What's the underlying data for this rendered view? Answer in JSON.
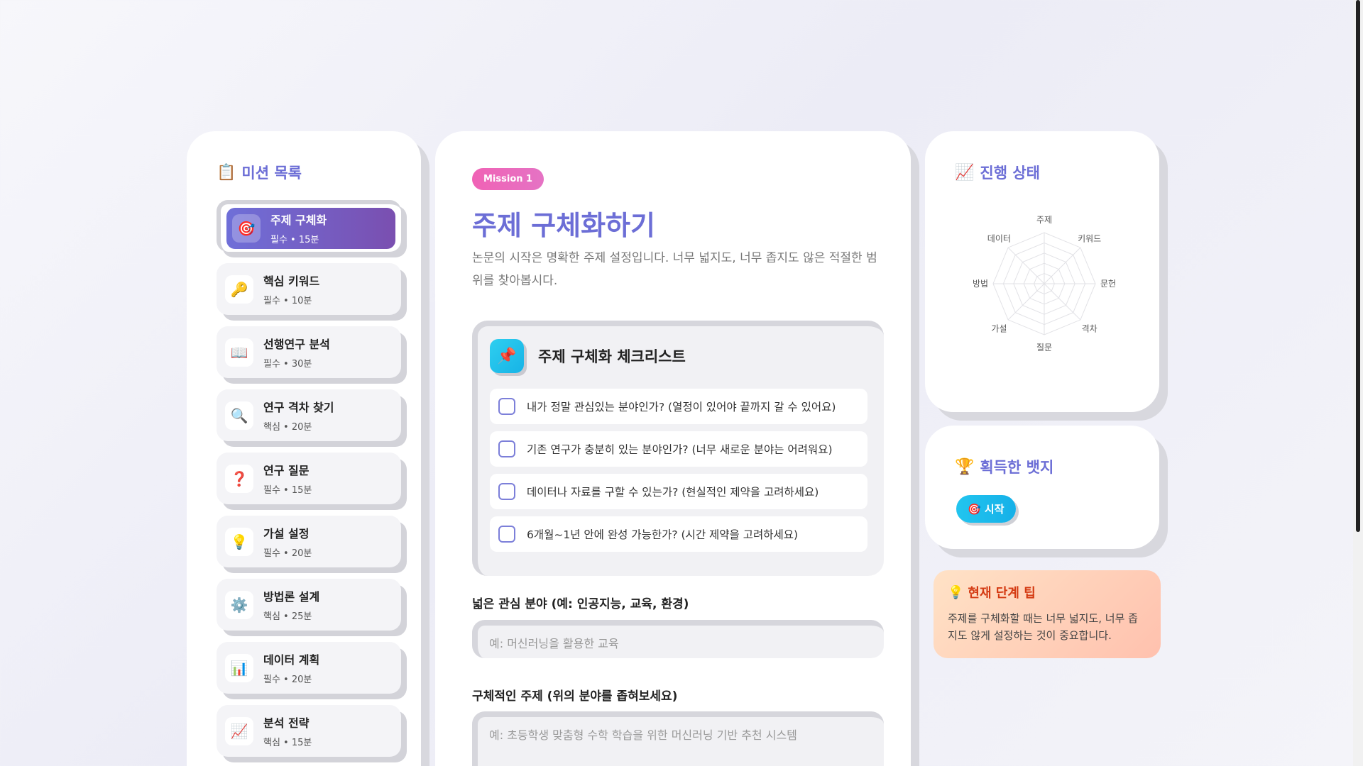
{
  "sidebar": {
    "title_emoji": "📋",
    "title": "미션 목록",
    "items": [
      {
        "icon": "🎯",
        "icon_name": "target-icon",
        "label": "주제 구체화",
        "meta": "필수 • 15분",
        "active": true
      },
      {
        "icon": "🔑",
        "icon_name": "key-icon",
        "label": "핵심 키워드",
        "meta": "필수 • 10분"
      },
      {
        "icon": "📖",
        "icon_name": "book-icon",
        "label": "선행연구 분석",
        "meta": "필수 • 30분"
      },
      {
        "icon": "🔍",
        "icon_name": "magnifier-icon",
        "label": "연구 격차 찾기",
        "meta": "핵심 • 20분"
      },
      {
        "icon": "❓",
        "icon_name": "question-icon",
        "label": "연구 질문",
        "meta": "필수 • 15분"
      },
      {
        "icon": "💡",
        "icon_name": "lightbulb-icon",
        "label": "가설 설정",
        "meta": "필수 • 20분"
      },
      {
        "icon": "⚙️",
        "icon_name": "gear-icon",
        "label": "방법론 설계",
        "meta": "핵심 • 25분"
      },
      {
        "icon": "📊",
        "icon_name": "bar-chart-icon",
        "label": "데이터 계획",
        "meta": "필수 • 20분"
      },
      {
        "icon": "📈",
        "icon_name": "trend-chart-icon",
        "label": "분석 전략",
        "meta": "핵심 • 15분"
      }
    ]
  },
  "main": {
    "badge": "Mission 1",
    "title": "주제 구체화하기",
    "description": "논문의 시작은 명확한 주제 설정입니다. 너무 넓지도, 너무 좁지도 않은 적절한 범위를 찾아봅시다.",
    "checklist": {
      "icon": "📌",
      "title": "주제 구체화 체크리스트",
      "items": [
        "내가 정말 관심있는 분야인가? (열정이 있어야 끝까지 갈 수 있어요)",
        "기존 연구가 충분히 있는 분야인가? (너무 새로운 분야는 어려워요)",
        "데이터나 자료를 구할 수 있는가? (현실적인 제약을 고려하세요)",
        "6개월~1년 안에 완성 가능한가? (시간 제약을 고려하세요)"
      ]
    },
    "field1": {
      "label": "넓은 관심 분야 (예: 인공지능, 교육, 환경)",
      "placeholder": "예: 머신러닝을 활용한 교육"
    },
    "field2": {
      "label": "구체적인 주제 (위의 분야를 좁혀보세요)",
      "placeholder": "예: 초등학생 맞춤형 수학 학습을 위한 머신러닝 기반 추천 시스템"
    }
  },
  "progress": {
    "title_emoji": "📈",
    "title": "진행 상태",
    "radar_labels": [
      "주제",
      "키워드",
      "문헌",
      "격차",
      "질문",
      "가설",
      "방법",
      "데이터"
    ],
    "values": [
      0,
      0,
      0,
      0,
      0,
      0,
      0,
      0
    ]
  },
  "badges": {
    "title_emoji": "🏆",
    "title": "획득한 뱃지",
    "items": [
      {
        "icon": "🎯",
        "label": "시작"
      }
    ]
  },
  "tip": {
    "emoji": "💡",
    "title": "현재 단계 팁",
    "text": "주제를 구체화할 때는 너무 넓지도, 너무 좁지도 않게 설정하는 것이 중요합니다."
  }
}
